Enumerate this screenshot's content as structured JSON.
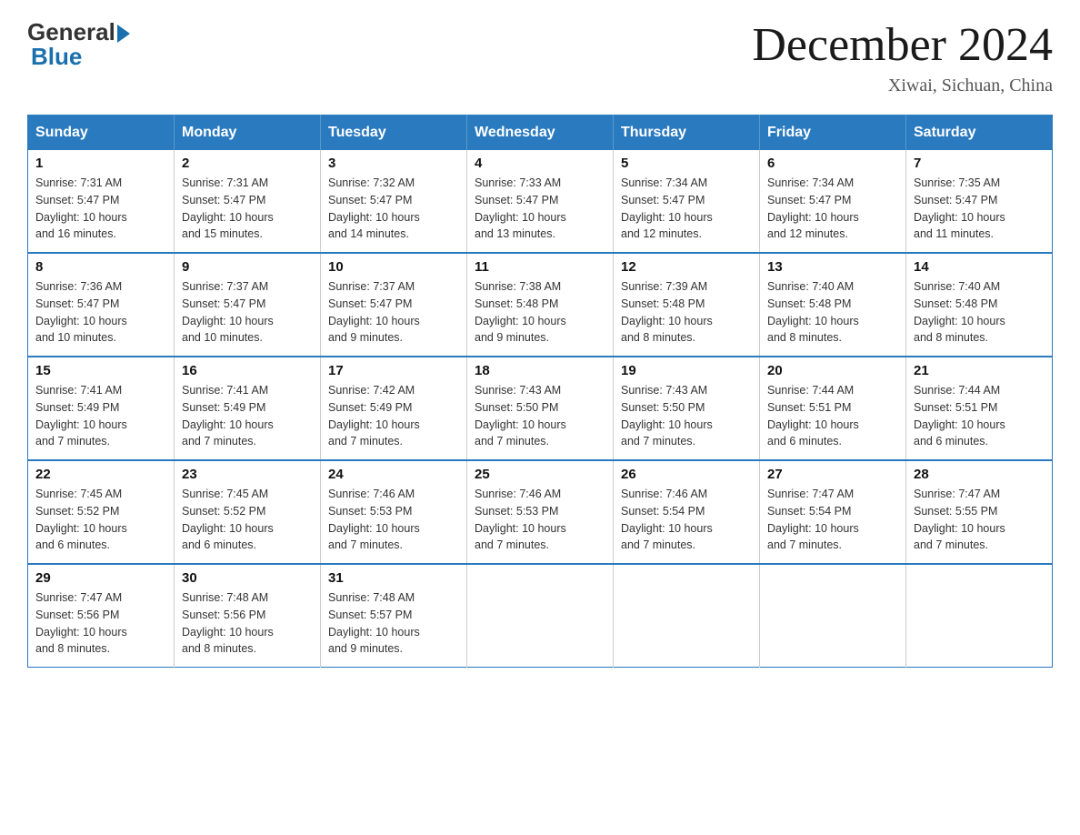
{
  "logo": {
    "general_text": "General",
    "blue_text": "Blue"
  },
  "header": {
    "month_title": "December 2024",
    "location": "Xiwai, Sichuan, China"
  },
  "days_of_week": [
    "Sunday",
    "Monday",
    "Tuesday",
    "Wednesday",
    "Thursday",
    "Friday",
    "Saturday"
  ],
  "weeks": [
    [
      {
        "day": "1",
        "sunrise": "7:31 AM",
        "sunset": "5:47 PM",
        "daylight": "10 hours and 16 minutes."
      },
      {
        "day": "2",
        "sunrise": "7:31 AM",
        "sunset": "5:47 PM",
        "daylight": "10 hours and 15 minutes."
      },
      {
        "day": "3",
        "sunrise": "7:32 AM",
        "sunset": "5:47 PM",
        "daylight": "10 hours and 14 minutes."
      },
      {
        "day": "4",
        "sunrise": "7:33 AM",
        "sunset": "5:47 PM",
        "daylight": "10 hours and 13 minutes."
      },
      {
        "day": "5",
        "sunrise": "7:34 AM",
        "sunset": "5:47 PM",
        "daylight": "10 hours and 12 minutes."
      },
      {
        "day": "6",
        "sunrise": "7:34 AM",
        "sunset": "5:47 PM",
        "daylight": "10 hours and 12 minutes."
      },
      {
        "day": "7",
        "sunrise": "7:35 AM",
        "sunset": "5:47 PM",
        "daylight": "10 hours and 11 minutes."
      }
    ],
    [
      {
        "day": "8",
        "sunrise": "7:36 AM",
        "sunset": "5:47 PM",
        "daylight": "10 hours and 10 minutes."
      },
      {
        "day": "9",
        "sunrise": "7:37 AM",
        "sunset": "5:47 PM",
        "daylight": "10 hours and 10 minutes."
      },
      {
        "day": "10",
        "sunrise": "7:37 AM",
        "sunset": "5:47 PM",
        "daylight": "10 hours and 9 minutes."
      },
      {
        "day": "11",
        "sunrise": "7:38 AM",
        "sunset": "5:48 PM",
        "daylight": "10 hours and 9 minutes."
      },
      {
        "day": "12",
        "sunrise": "7:39 AM",
        "sunset": "5:48 PM",
        "daylight": "10 hours and 8 minutes."
      },
      {
        "day": "13",
        "sunrise": "7:40 AM",
        "sunset": "5:48 PM",
        "daylight": "10 hours and 8 minutes."
      },
      {
        "day": "14",
        "sunrise": "7:40 AM",
        "sunset": "5:48 PM",
        "daylight": "10 hours and 8 minutes."
      }
    ],
    [
      {
        "day": "15",
        "sunrise": "7:41 AM",
        "sunset": "5:49 PM",
        "daylight": "10 hours and 7 minutes."
      },
      {
        "day": "16",
        "sunrise": "7:41 AM",
        "sunset": "5:49 PM",
        "daylight": "10 hours and 7 minutes."
      },
      {
        "day": "17",
        "sunrise": "7:42 AM",
        "sunset": "5:49 PM",
        "daylight": "10 hours and 7 minutes."
      },
      {
        "day": "18",
        "sunrise": "7:43 AM",
        "sunset": "5:50 PM",
        "daylight": "10 hours and 7 minutes."
      },
      {
        "day": "19",
        "sunrise": "7:43 AM",
        "sunset": "5:50 PM",
        "daylight": "10 hours and 7 minutes."
      },
      {
        "day": "20",
        "sunrise": "7:44 AM",
        "sunset": "5:51 PM",
        "daylight": "10 hours and 6 minutes."
      },
      {
        "day": "21",
        "sunrise": "7:44 AM",
        "sunset": "5:51 PM",
        "daylight": "10 hours and 6 minutes."
      }
    ],
    [
      {
        "day": "22",
        "sunrise": "7:45 AM",
        "sunset": "5:52 PM",
        "daylight": "10 hours and 6 minutes."
      },
      {
        "day": "23",
        "sunrise": "7:45 AM",
        "sunset": "5:52 PM",
        "daylight": "10 hours and 6 minutes."
      },
      {
        "day": "24",
        "sunrise": "7:46 AM",
        "sunset": "5:53 PM",
        "daylight": "10 hours and 7 minutes."
      },
      {
        "day": "25",
        "sunrise": "7:46 AM",
        "sunset": "5:53 PM",
        "daylight": "10 hours and 7 minutes."
      },
      {
        "day": "26",
        "sunrise": "7:46 AM",
        "sunset": "5:54 PM",
        "daylight": "10 hours and 7 minutes."
      },
      {
        "day": "27",
        "sunrise": "7:47 AM",
        "sunset": "5:54 PM",
        "daylight": "10 hours and 7 minutes."
      },
      {
        "day": "28",
        "sunrise": "7:47 AM",
        "sunset": "5:55 PM",
        "daylight": "10 hours and 7 minutes."
      }
    ],
    [
      {
        "day": "29",
        "sunrise": "7:47 AM",
        "sunset": "5:56 PM",
        "daylight": "10 hours and 8 minutes."
      },
      {
        "day": "30",
        "sunrise": "7:48 AM",
        "sunset": "5:56 PM",
        "daylight": "10 hours and 8 minutes."
      },
      {
        "day": "31",
        "sunrise": "7:48 AM",
        "sunset": "5:57 PM",
        "daylight": "10 hours and 9 minutes."
      },
      null,
      null,
      null,
      null
    ]
  ],
  "labels": {
    "sunrise": "Sunrise:",
    "sunset": "Sunset:",
    "daylight": "Daylight:"
  }
}
